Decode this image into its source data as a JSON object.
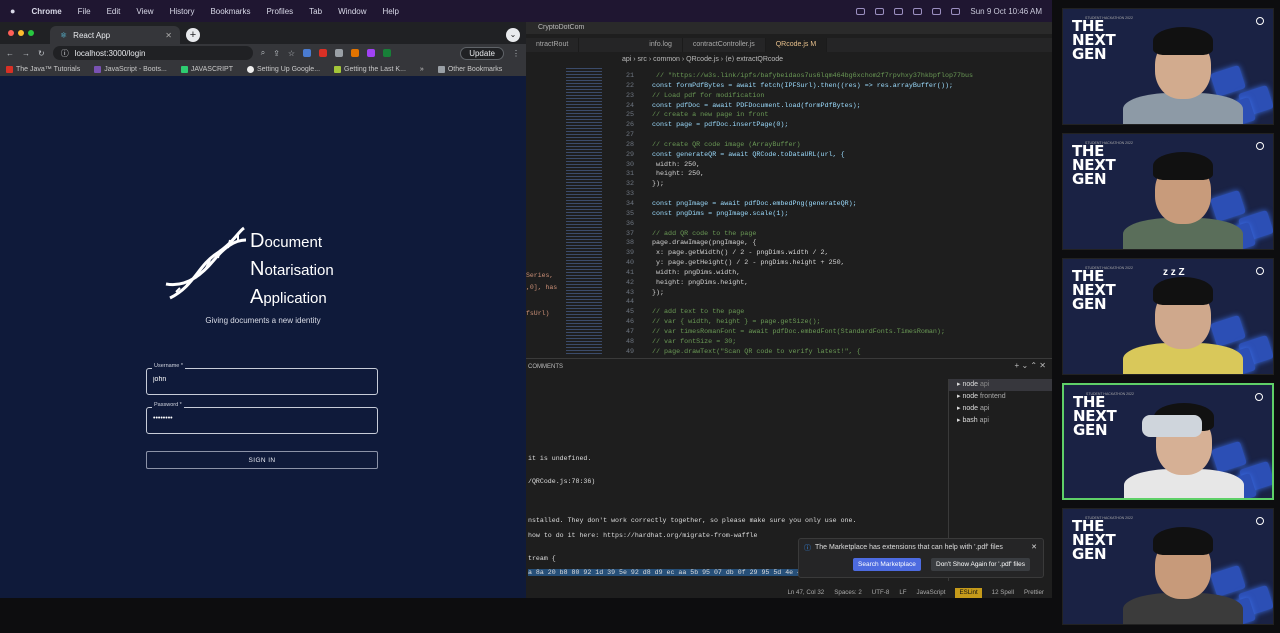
{
  "menubar": {
    "app": "Chrome",
    "items": [
      "File",
      "Edit",
      "View",
      "History",
      "Bookmarks",
      "Profiles",
      "Tab",
      "Window",
      "Help"
    ],
    "clock": "Sun 9 Oct 10:46 AM"
  },
  "browser": {
    "tab_title": "React App",
    "url": "localhost:3000/login",
    "update_label": "Update",
    "bookmarks": [
      "The Java™ Tutorials",
      "JavaScript - Boots...",
      "JAVASCRIPT",
      "Setting Up Google...",
      "Getting the Last K..."
    ],
    "other_bookmarks": "Other Bookmarks"
  },
  "login": {
    "logo": {
      "l1": "D",
      "r1": "ocument",
      "l2": "N",
      "r2": "otarisation",
      "l3": "A",
      "r3": "pplication"
    },
    "tagline": "Giving documents a new identity",
    "username": {
      "label": "Username *",
      "value": "john"
    },
    "password": {
      "label": "Password *",
      "value": "••••••••"
    },
    "signin_label": "SIGN IN"
  },
  "vscode": {
    "title": "CryptoDotCom",
    "tabs": [
      "ntractRout",
      "info.log",
      "contractController.js",
      "QRcode.js M"
    ],
    "breadcrumb": "api › src › common › QRcode.js › ⟨e⟩ extractQRcode",
    "code": [
      {
        "n": "21",
        "t": "  //  \"https://w3s.link/ipfs/bafybeidaos7us6lqm464bg6xchom2f7rpvhxy37hkbpflop77bus"
      },
      {
        "n": "22",
        "t": "const formPdfBytes = await fetch(IPFSurl).then((res) => res.arrayBuffer());"
      },
      {
        "n": "23",
        "t": "// Load pdf for modification"
      },
      {
        "n": "24",
        "t": "const pdfDoc = await PDFDocument.load(formPdfBytes);"
      },
      {
        "n": "25",
        "t": "// create a new page in front"
      },
      {
        "n": "26",
        "t": "const page = pdfDoc.insertPage(0);"
      },
      {
        "n": "27",
        "t": ""
      },
      {
        "n": "28",
        "t": "// create QR code image (ArrayBuffer)"
      },
      {
        "n": "29",
        "t": "const generateQR = await QRCode.toDataURL(url, {"
      },
      {
        "n": "30",
        "t": "  width: 250,"
      },
      {
        "n": "31",
        "t": "  height: 250,"
      },
      {
        "n": "32",
        "t": "});"
      },
      {
        "n": "33",
        "t": ""
      },
      {
        "n": "34",
        "t": "const pngImage = await pdfDoc.embedPng(generateQR);"
      },
      {
        "n": "35",
        "t": "const pngDims = pngImage.scale(1);"
      },
      {
        "n": "36",
        "t": ""
      },
      {
        "n": "37",
        "t": "// add QR code to the page"
      },
      {
        "n": "38",
        "t": "page.drawImage(pngImage, {"
      },
      {
        "n": "39",
        "t": "  x: page.getWidth() / 2 - pngDims.width / 2,"
      },
      {
        "n": "40",
        "t": "  y: page.getHeight() / 2 - pngDims.height + 250,"
      },
      {
        "n": "41",
        "t": "  width: pngDims.width,"
      },
      {
        "n": "42",
        "t": "  height: pngDims.height,"
      },
      {
        "n": "43",
        "t": "});"
      },
      {
        "n": "44",
        "t": ""
      },
      {
        "n": "45",
        "t": "// add text to the page"
      },
      {
        "n": "46",
        "t": "// var { width, height } = page.getSize();"
      },
      {
        "n": "47",
        "t": "// var timesRomanFont = await pdfDoc.embedFont(StandardFonts.TimesRoman);"
      },
      {
        "n": "48",
        "t": "// var fontSize = 30;"
      },
      {
        "n": "49",
        "t": "// page.drawText(\"Scan QR code to verify latest!\", {"
      }
    ],
    "left_snips": [
      "Series,",
      ",0], has",
      "fsUrl)"
    ],
    "panel_title": "COMMENTS",
    "terminal": [
      "it is undefined.",
      "/QRCode.js:78:36)",
      "nstalled. They don't work correctly together, so please make sure you only use one.",
      "how to do it here: https://hardhat.org/migrate-from-waffle",
      "tream {",
      "a 8a 20 b8 80 92 1d 39 5e 92 d8 d9 ec aa 5b 95 07 db 0f 29 95 5d 4e 4a"
    ],
    "terminals": [
      {
        "name": "node",
        "dir": "api"
      },
      {
        "name": "node",
        "dir": "frontend"
      },
      {
        "name": "node",
        "dir": "api"
      },
      {
        "name": "bash",
        "dir": "api"
      }
    ],
    "notification": {
      "message": "The Marketplace has extensions that can help with '.pdf' files",
      "primary": "Search Marketplace",
      "secondary": "Don't Show Again for '.pdf' files"
    },
    "status": {
      "pos": "Ln 47, Col 32",
      "spaces": "Spaces: 2",
      "enc": "UTF-8",
      "eol": "LF",
      "lang": "JavaScript",
      "eslint": "ESLint",
      "spell": "12 Spell",
      "prettier": "Prettier"
    }
  },
  "participants": {
    "brand_l1": "THE",
    "brand_l2": "NEXT",
    "brand_l3": "GEN",
    "sleep": "z z Z",
    "event": "STUDENT HACKATHON 2022"
  }
}
